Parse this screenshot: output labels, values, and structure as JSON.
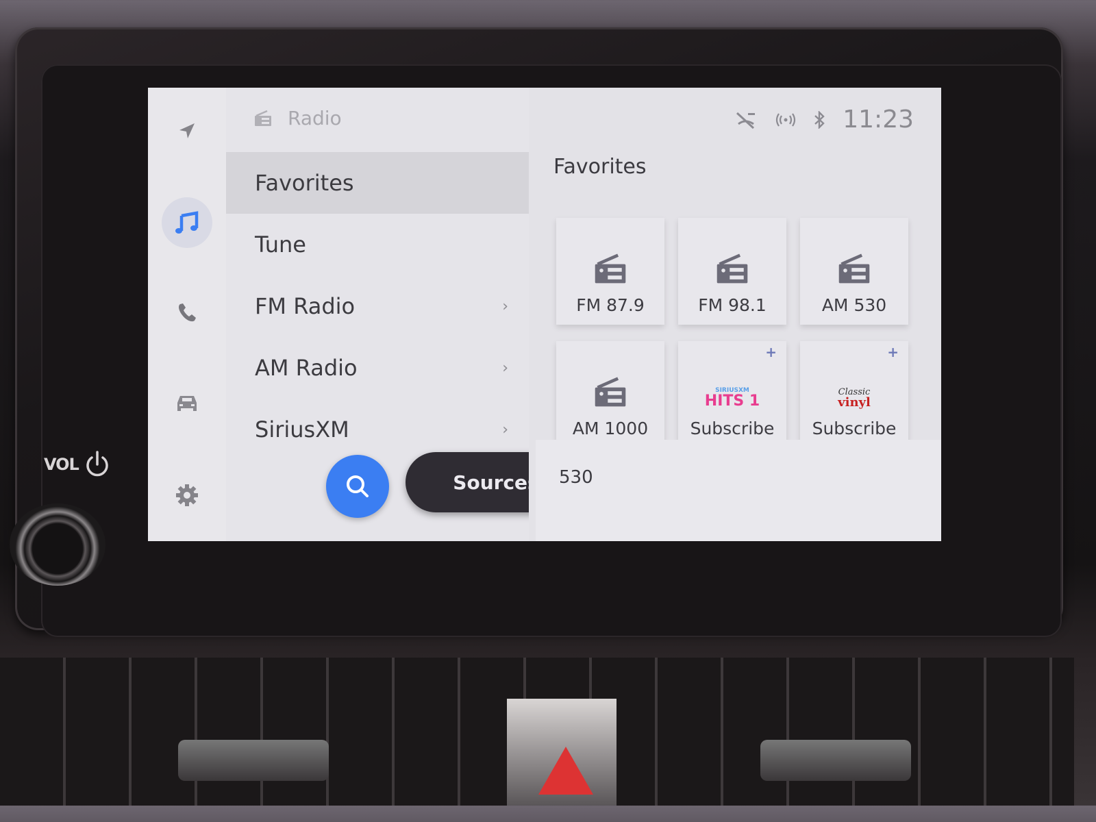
{
  "hardware": {
    "vol_label": "VOL"
  },
  "header": {
    "title": "Radio",
    "title_icon": "radio-icon",
    "time": "11:23",
    "status_icons": [
      "no-signal-icon",
      "wireless-icon",
      "bluetooth-icon"
    ]
  },
  "rail": {
    "items": [
      {
        "name": "navigation",
        "icon": "navigation-arrow-icon",
        "active": false
      },
      {
        "name": "media",
        "icon": "music-note-icon",
        "active": true
      },
      {
        "name": "phone",
        "icon": "phone-icon",
        "active": false
      },
      {
        "name": "vehicle",
        "icon": "car-icon",
        "active": false
      },
      {
        "name": "settings",
        "icon": "gear-icon",
        "active": false
      }
    ],
    "accent": "#3b7ef2"
  },
  "menu": {
    "items": [
      {
        "label": "Favorites",
        "selected": true,
        "has_chevron": false
      },
      {
        "label": "Tune",
        "selected": false,
        "has_chevron": false
      },
      {
        "label": "FM Radio",
        "selected": false,
        "has_chevron": true
      },
      {
        "label": "AM Radio",
        "selected": false,
        "has_chevron": true
      },
      {
        "label": "SiriusXM",
        "selected": false,
        "has_chevron": true
      }
    ],
    "chevron_glyph": "›",
    "search_button": "search-icon",
    "sources_label": "Sources"
  },
  "favorites": {
    "title": "Favorites",
    "tiles": [
      {
        "label": "FM 87.9",
        "type": "radio"
      },
      {
        "label": "FM 98.1",
        "type": "radio"
      },
      {
        "label": "AM 530",
        "type": "radio"
      },
      {
        "label": "AM 1000",
        "type": "radio"
      },
      {
        "label": "Subscribe",
        "type": "sirius-hits1",
        "logo_top": "SIRIUSXM",
        "logo_main": "HITS 1",
        "add": "+"
      },
      {
        "label": "Subscribe",
        "type": "classic-vinyl",
        "logo_top": "Classic",
        "logo_main": "vinyl",
        "add": "+"
      }
    ]
  },
  "now_playing": {
    "station": "530"
  }
}
